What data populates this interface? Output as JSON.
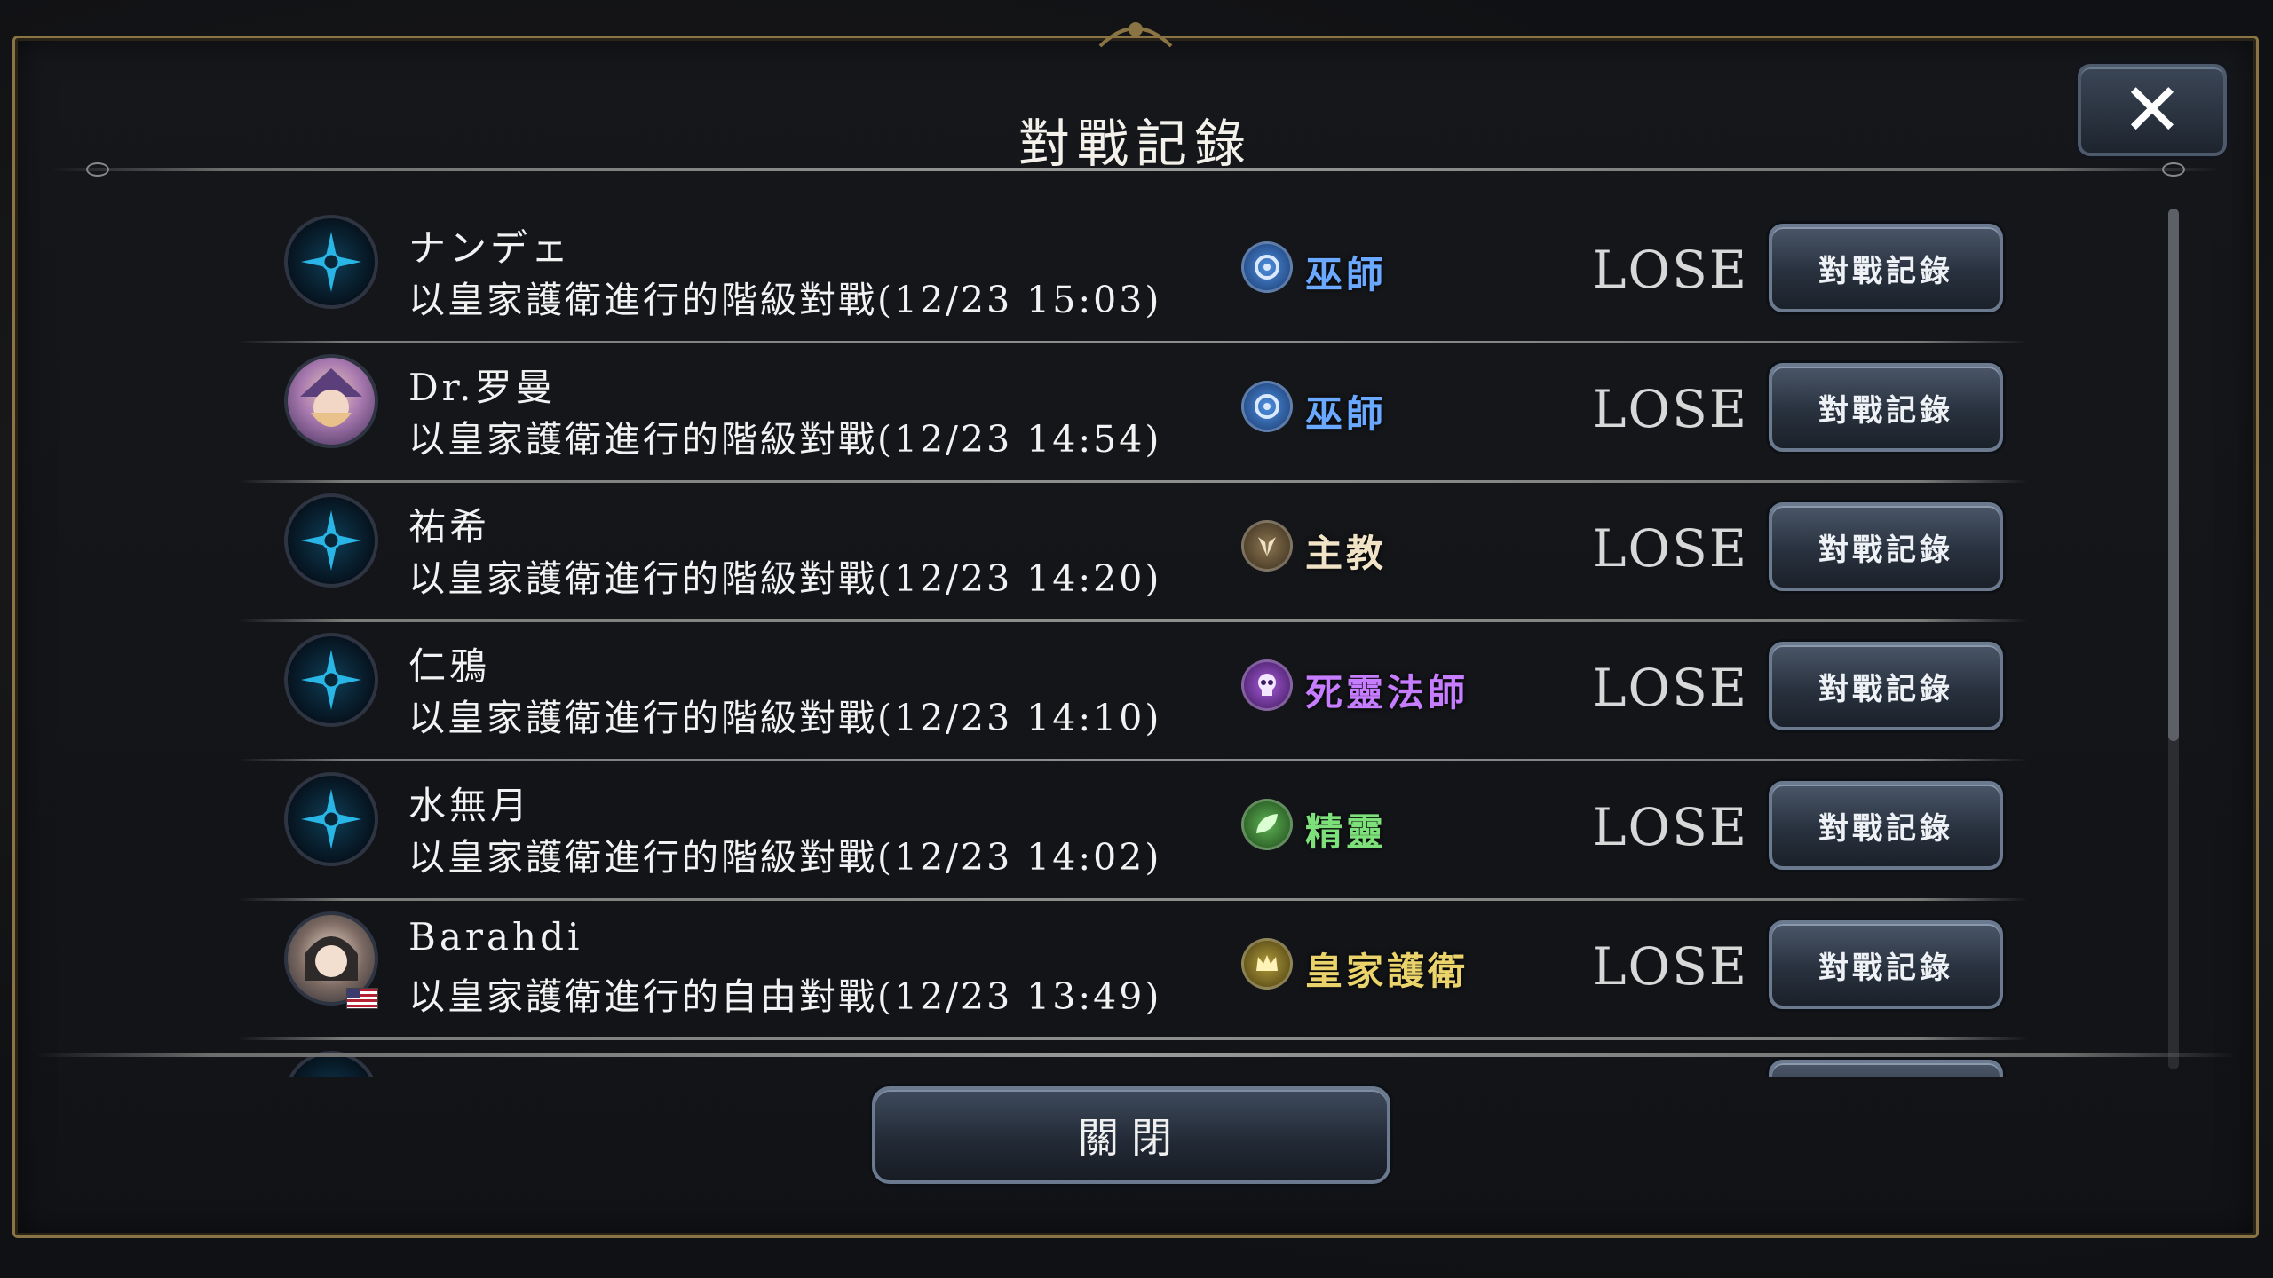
{
  "modal": {
    "title": "對戰記錄",
    "close_icon": "close-icon",
    "close_button_label": "關閉"
  },
  "records": [
    {
      "name": "ナンデェ",
      "detail": "以皇家護衛進行的階級對戰(12/23 15:03)",
      "class_label": "巫師",
      "class_icon": "rune-icon",
      "class_color": "#6aa9ff",
      "result": "LOSE",
      "button_label": "對戰記錄",
      "avatar": "emblem-avatar"
    },
    {
      "name": "Dr.罗曼",
      "detail": "以皇家護衛進行的階級對戰(12/23 14:54)",
      "class_label": "巫師",
      "class_icon": "rune-icon",
      "class_color": "#6aa9ff",
      "result": "LOSE",
      "button_label": "對戰記錄",
      "avatar": "portrait-avatar"
    },
    {
      "name": "祐希",
      "detail": "以皇家護衛進行的階級對戰(12/23 14:20)",
      "class_label": "主教",
      "class_icon": "wing-icon",
      "class_color": "#f1e4c6",
      "result": "LOSE",
      "button_label": "對戰記錄",
      "avatar": "emblem-avatar"
    },
    {
      "name": "仁鴉",
      "detail": "以皇家護衛進行的階級對戰(12/23 14:10)",
      "class_label": "死靈法師",
      "class_icon": "skull-icon",
      "class_color": "#c77dff",
      "result": "LOSE",
      "button_label": "對戰記錄",
      "avatar": "emblem-avatar"
    },
    {
      "name": "水無月",
      "detail": "以皇家護衛進行的階級對戰(12/23 14:02)",
      "class_label": "精靈",
      "class_icon": "leaf-icon",
      "class_color": "#7ee07a",
      "result": "LOSE",
      "button_label": "對戰記錄",
      "avatar": "emblem-avatar"
    },
    {
      "name": "Barahdi",
      "detail": "以皇家護衛進行的自由對戰(12/23 13:49)",
      "class_label": "皇家護衛",
      "class_icon": "crown-icon",
      "class_color": "#e9d36a",
      "result": "LOSE",
      "button_label": "對戰記錄",
      "avatar": "portrait-avatar-flag"
    }
  ]
}
